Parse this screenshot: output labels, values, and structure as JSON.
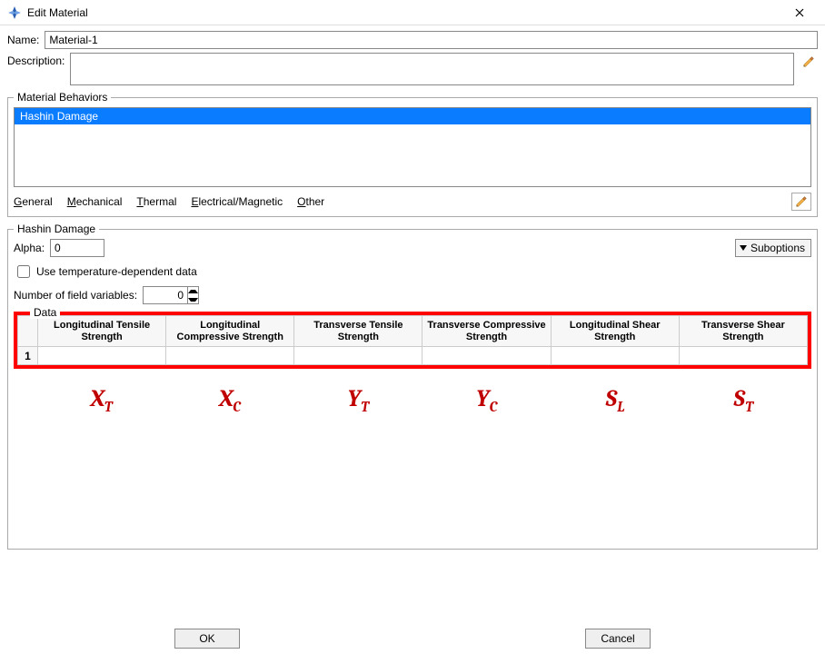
{
  "window": {
    "title": "Edit Material"
  },
  "form": {
    "name_label": "Name:",
    "name_value": "Material-1",
    "description_label": "Description:",
    "description_value": ""
  },
  "behaviors": {
    "legend": "Material Behaviors",
    "items": [
      "Hashin Damage"
    ],
    "selected_index": 0
  },
  "menu": {
    "general": "General",
    "mechanical": "Mechanical",
    "thermal": "Thermal",
    "electrical_magnetic": "Electrical/Magnetic",
    "other": "Other"
  },
  "hashin": {
    "legend": "Hashin Damage",
    "alpha_label": "Alpha:",
    "alpha_value": "0",
    "suboptions_label": "Suboptions",
    "use_temp_label": "Use temperature-dependent data",
    "use_temp_checked": false,
    "nfv_label": "Number of field variables:",
    "nfv_value": "0",
    "data_legend": "Data",
    "columns": [
      "Longitudinal Tensile Strength",
      "Longitudinal Compressive Strength",
      "Transverse Tensile Strength",
      "Transverse Compressive Strength",
      "Longitudinal Shear Strength",
      "Transverse Shear Strength"
    ],
    "rows": [
      {
        "num": "1",
        "cells": [
          "",
          "",
          "",
          "",
          "",
          ""
        ]
      }
    ]
  },
  "annotation_symbols": {
    "s0": {
      "base": "X",
      "sub": "T"
    },
    "s1": {
      "base": "X",
      "sub": "C"
    },
    "s2": {
      "base": "Y",
      "sub": "T"
    },
    "s3": {
      "base": "Y",
      "sub": "C"
    },
    "s4": {
      "base": "S",
      "sub": "L"
    },
    "s5": {
      "base": "S",
      "sub": "T"
    }
  },
  "footer": {
    "ok": "OK",
    "cancel": "Cancel"
  }
}
